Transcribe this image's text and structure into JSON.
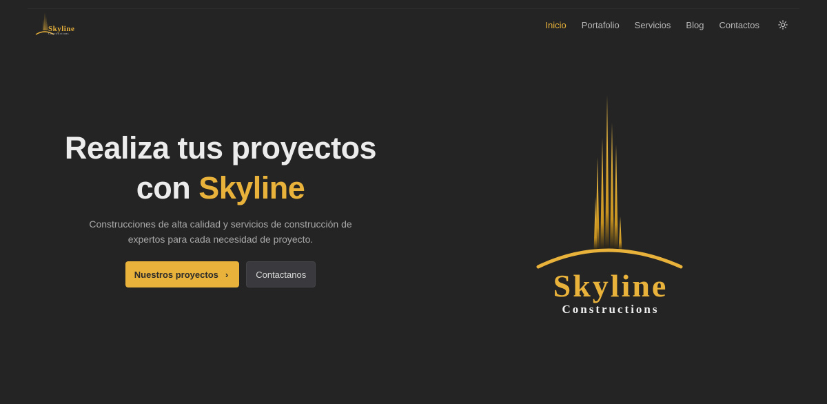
{
  "nav": {
    "brand_name": "Skyline",
    "brand_sub": "Constructions",
    "links": [
      "Inicio",
      "Portafolio",
      "Servicios",
      "Blog",
      "Contactos"
    ],
    "active_index": 0,
    "theme_icon": "sun-icon"
  },
  "hero": {
    "title_line1": "Realiza tus proyectos",
    "title_prefix": "con",
    "title_accent": "Skyline",
    "subtitle": "Construcciones de alta calidad y servicios de construcción de expertos para cada necesidad de proyecto.",
    "primary_button": "Nuestros proyectos",
    "primary_icon": "chevron-right-icon",
    "secondary_button": "Contactanos"
  },
  "logo": {
    "word": "Skyline",
    "sub": "Constructions"
  },
  "colors": {
    "background": "#242424",
    "accent": "#e9b23a",
    "text": "#ececec",
    "muted": "#a9a9a9"
  }
}
